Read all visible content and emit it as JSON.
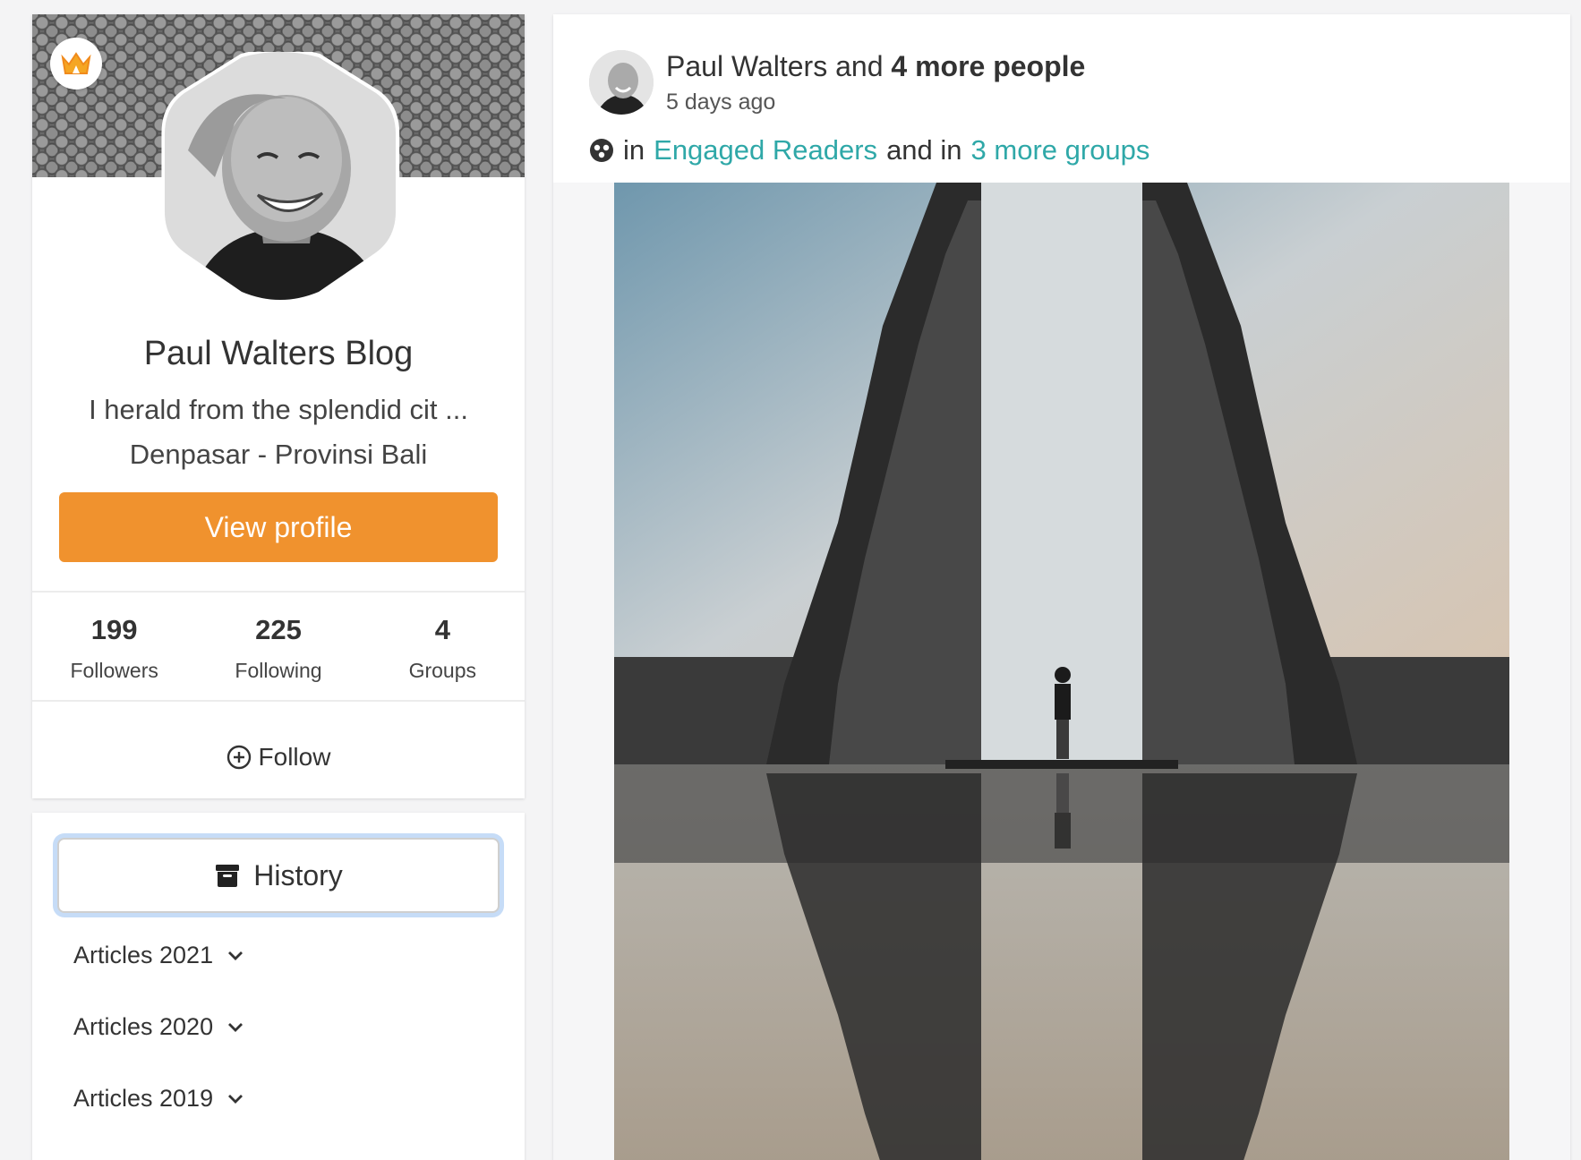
{
  "profile": {
    "name": "Paul Walters Blog",
    "bio": "I herald from the splendid cit ...",
    "location": "Denpasar - Provinsi Bali",
    "view_profile_label": "View profile",
    "follow_label": "Follow",
    "badge_icon": "crown-icon",
    "accent_color": "#f0922e",
    "stats": [
      {
        "value": "199",
        "label": "Followers"
      },
      {
        "value": "225",
        "label": "Following"
      },
      {
        "value": "4",
        "label": "Groups"
      }
    ]
  },
  "history": {
    "button_label": "History",
    "items": [
      {
        "label": "Articles 2021"
      },
      {
        "label": "Articles 2020"
      },
      {
        "label": "Articles 2019"
      }
    ]
  },
  "post": {
    "author": "Paul Walters",
    "and_text": "and",
    "more_people": "4 more people",
    "time": "5 days ago",
    "in_text": "in",
    "group": "Engaged Readers",
    "and_in_text": "and in",
    "more_groups": "3 more groups",
    "link_color": "#2fa8a8"
  }
}
